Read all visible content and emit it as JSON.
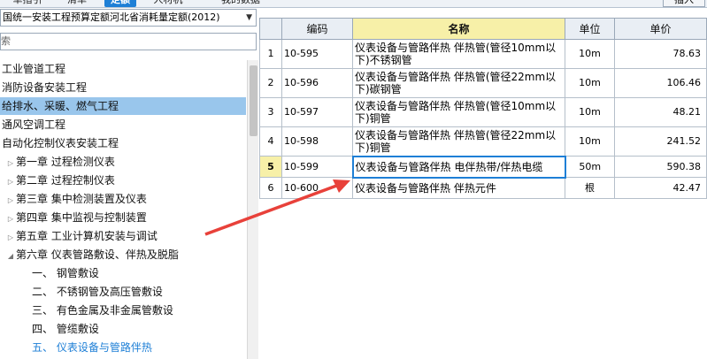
{
  "toolbar": {
    "tabs": [
      "单指引",
      "清单",
      "定额",
      "人材机",
      "我的数据"
    ],
    "active_tab": 2,
    "insert_label": "插入",
    "accent": "#1e7fd6"
  },
  "left": {
    "quota_library": "国统一安装工程预算定额河北省消耗量定额(2012)",
    "search_placeholder": "索",
    "tree": [
      {
        "label": "工业管道工程",
        "level": 0,
        "toggle": ""
      },
      {
        "label": "消防设备安装工程",
        "level": 0,
        "toggle": ""
      },
      {
        "label": "给排水、采暖、燃气工程",
        "level": 0,
        "toggle": "",
        "selected": true
      },
      {
        "label": "通风空调工程",
        "level": 0,
        "toggle": ""
      },
      {
        "label": "自动化控制仪表安装工程",
        "level": 0,
        "toggle": ""
      },
      {
        "label": "第一章  过程检测仪表",
        "level": 1,
        "toggle": "▷"
      },
      {
        "label": "第二章  过程控制仪表",
        "level": 1,
        "toggle": "▷"
      },
      {
        "label": "第三章  集中检测装置及仪表",
        "level": 1,
        "toggle": "▷"
      },
      {
        "label": "第四章  集中监视与控制装置",
        "level": 1,
        "toggle": "▷"
      },
      {
        "label": "第五章  工业计算机安装与调试",
        "level": 1,
        "toggle": "▷"
      },
      {
        "label": "第六章  仪表管路敷设、伴热及脱脂",
        "level": 1,
        "toggle": "◢"
      },
      {
        "label": "一、  钢管敷设",
        "level": 2,
        "toggle": ""
      },
      {
        "label": "二、  不锈钢管及高压管敷设",
        "level": 2,
        "toggle": ""
      },
      {
        "label": "三、  有色金属及非金属管敷设",
        "level": 2,
        "toggle": ""
      },
      {
        "label": "四、  管缆敷设",
        "level": 2,
        "toggle": ""
      },
      {
        "label": "五、  仪表设备与管路伴热",
        "level": 2,
        "toggle": "",
        "current": true
      }
    ]
  },
  "grid": {
    "headers": {
      "code": "编码",
      "name": "名称",
      "unit": "单位",
      "price": "单价"
    },
    "rows": [
      {
        "idx": "1",
        "code": "10-595",
        "name": "仪表设备与管路伴热 伴热管(管径10mm以下)不锈钢管",
        "unit": "10m",
        "price": "78.63"
      },
      {
        "idx": "2",
        "code": "10-596",
        "name": "仪表设备与管路伴热 伴热管(管径22mm以下)碳钢管",
        "unit": "10m",
        "price": "106.46"
      },
      {
        "idx": "3",
        "code": "10-597",
        "name": "仪表设备与管路伴热 伴热管(管径10mm以下)铜管",
        "unit": "10m",
        "price": "48.21"
      },
      {
        "idx": "4",
        "code": "10-598",
        "name": "仪表设备与管路伴热 伴热管(管径22mm以下)铜管",
        "unit": "10m",
        "price": "241.52"
      },
      {
        "idx": "5",
        "code": "10-599",
        "name": "仪表设备与管路伴热 电伴热带/伴热电缆",
        "unit": "50m",
        "price": "590.38",
        "current": true
      },
      {
        "idx": "6",
        "code": "10-600",
        "name": "仪表设备与管路伴热 伴热元件",
        "unit": "根",
        "price": "42.47"
      }
    ]
  },
  "annotation": {
    "arrow_color": "#e8413a"
  }
}
